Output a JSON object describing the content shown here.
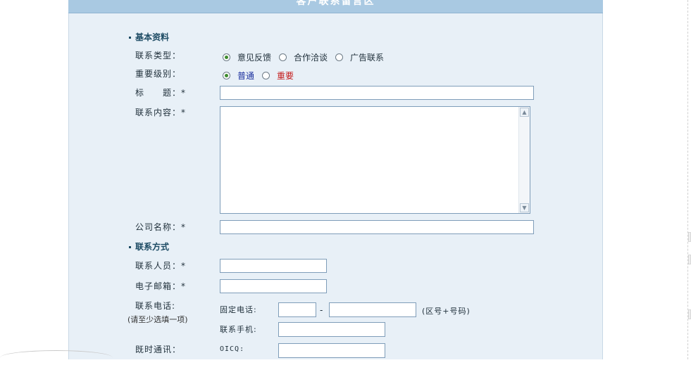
{
  "header": {
    "title": "客户联系留言区"
  },
  "sections": {
    "basic": "基本资料",
    "contact": "联系方式"
  },
  "labels": {
    "contact_type": "联系类型：",
    "importance": "重要级别：",
    "title": "标　　题：*",
    "content": "联系内容：*",
    "company": "公司名称：*",
    "person": "联系人员：*",
    "email": "电子邮箱：*",
    "phone": "联系电话:",
    "phone_hint": "(请至少选填一项)",
    "im": "既时通讯：",
    "landline": "固定电话:",
    "dash": "-",
    "area_hint": "(区号+号码)",
    "mobile": "联系手机:",
    "oicq": "OICQ:"
  },
  "contact_type_options": [
    {
      "label": "意见反馈",
      "selected": true
    },
    {
      "label": "合作洽谈",
      "selected": false
    },
    {
      "label": "广告联系",
      "selected": false
    }
  ],
  "importance_options": [
    {
      "label": "普通",
      "selected": true,
      "color": "#1a2f9e"
    },
    {
      "label": "重要",
      "selected": false,
      "color": "#c41a1a"
    }
  ],
  "fields": {
    "title": "",
    "content": "",
    "company": "",
    "person": "",
    "email": "",
    "area_code": "",
    "number": "",
    "mobile": "",
    "oicq": ""
  },
  "icons": {
    "scroll_up": "scroll-up-arrow-icon",
    "scroll_down": "scroll-down-arrow-icon"
  }
}
